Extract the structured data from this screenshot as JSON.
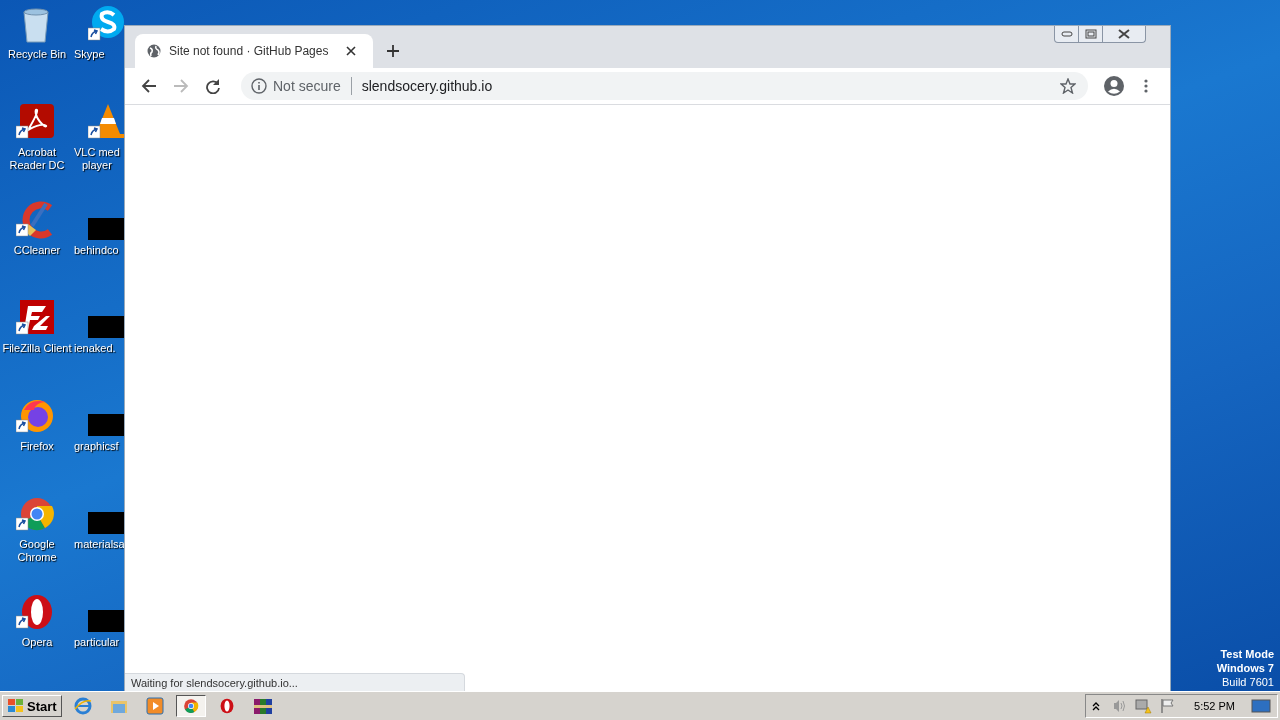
{
  "desktop": {
    "icons": [
      {
        "kind": "recycle",
        "label": "Recycle Bin",
        "shortcut": false
      },
      {
        "kind": "acrobat",
        "label": "Acrobat Reader DC",
        "shortcut": true
      },
      {
        "kind": "ccleaner",
        "label": "CCleaner",
        "shortcut": true
      },
      {
        "kind": "filezilla",
        "label": "FileZilla Client",
        "shortcut": true
      },
      {
        "kind": "firefox",
        "label": "Firefox",
        "shortcut": true
      },
      {
        "kind": "chrome",
        "label": "Google Chrome",
        "shortcut": true
      },
      {
        "kind": "opera",
        "label": "Opera",
        "shortcut": true
      }
    ],
    "partial_icons": [
      {
        "kind": "skype",
        "label": "Skype",
        "shortcut": true
      },
      {
        "kind": "vlc",
        "label": "VLC med\nplayer",
        "shortcut": true
      },
      {
        "kind": "redacted",
        "label": "behindco"
      },
      {
        "kind": "redacted",
        "label": "ienaked."
      },
      {
        "kind": "redacted",
        "label": "graphicsf"
      },
      {
        "kind": "redacted",
        "label": "materialsa"
      },
      {
        "kind": "redacted",
        "label": "particular"
      }
    ],
    "os_notice": [
      "Test Mode",
      "Windows 7",
      "Build 7601"
    ]
  },
  "browser": {
    "tabs": [
      {
        "title": "Site not found · GitHub Pages",
        "selected": true
      }
    ],
    "address_bar": {
      "security": "Not secure",
      "url": "slendsocery.github.io"
    },
    "status": "Waiting for slendsocery.github.io..."
  },
  "taskbar": {
    "start": "Start",
    "apps": [
      {
        "kind": "ie",
        "selected": false
      },
      {
        "kind": "explorer",
        "selected": false
      },
      {
        "kind": "media",
        "selected": false
      },
      {
        "kind": "chrome",
        "selected": true
      },
      {
        "kind": "opera",
        "selected": false
      },
      {
        "kind": "winrar",
        "selected": false
      }
    ],
    "clock": "5:52 PM"
  }
}
